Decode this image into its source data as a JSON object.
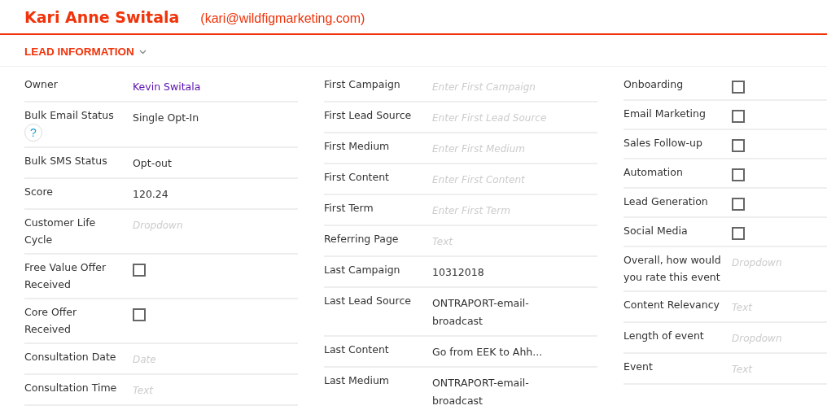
{
  "contact": {
    "name": "Kari Anne Switala",
    "email": "(kari@wildfigmarketing.com)"
  },
  "section": {
    "title": "LEAD INFORMATION",
    "expanded": true
  },
  "columns": [
    [
      {
        "label": "Owner",
        "kind": "link",
        "value": "Kevin Switala"
      },
      {
        "label": "Bulk Email Status",
        "kind": "value",
        "value": "Single Opt-In",
        "help": "?"
      },
      {
        "label": "Bulk SMS Status",
        "kind": "value",
        "value": "Opt-out"
      },
      {
        "label": "Score",
        "kind": "value",
        "value": "120.24"
      },
      {
        "label": "Customer Life Cycle",
        "kind": "empty",
        "placeholder": "Dropdown"
      },
      {
        "label": "Free Value Offer Received",
        "kind": "checkbox",
        "checked": false
      },
      {
        "label": "Core Offer Received",
        "kind": "checkbox",
        "checked": false
      },
      {
        "label": "Consultation Date",
        "kind": "empty",
        "placeholder": "Date"
      },
      {
        "label": "Consultation Time",
        "kind": "empty",
        "placeholder": "Text"
      }
    ],
    [
      {
        "label": "First Campaign",
        "kind": "empty",
        "placeholder": "Enter First Campaign"
      },
      {
        "label": "First Lead Source",
        "kind": "empty",
        "placeholder": "Enter First Lead Source"
      },
      {
        "label": "First Medium",
        "kind": "empty",
        "placeholder": "Enter First Medium"
      },
      {
        "label": "First Content",
        "kind": "empty",
        "placeholder": "Enter First Content"
      },
      {
        "label": "First Term",
        "kind": "empty",
        "placeholder": "Enter First Term"
      },
      {
        "label": "Referring Page",
        "kind": "empty",
        "placeholder": "Text"
      },
      {
        "label": "Last Campaign",
        "kind": "value",
        "value": "10312018"
      },
      {
        "label": "Last Lead Source",
        "kind": "value",
        "value": "ONTRAPORT-email-broadcast"
      },
      {
        "label": "Last Content",
        "kind": "value",
        "value": "Go from EEK to Ahh..."
      },
      {
        "label": "Last Medium",
        "kind": "value",
        "value": "ONTRAPORT-email-broadcast"
      }
    ],
    [
      {
        "label": "Onboarding",
        "kind": "checkbox",
        "checked": false
      },
      {
        "label": "Email Marketing",
        "kind": "checkbox",
        "checked": false
      },
      {
        "label": "Sales Follow-up",
        "kind": "checkbox",
        "checked": false
      },
      {
        "label": "Automation",
        "kind": "checkbox",
        "checked": false
      },
      {
        "label": "Lead Generation",
        "kind": "checkbox",
        "checked": false
      },
      {
        "label": "Social Media",
        "kind": "checkbox",
        "checked": false
      },
      {
        "label": "Overall, how would you rate this event",
        "kind": "empty",
        "placeholder": "Dropdown"
      },
      {
        "label": "Content Relevancy",
        "kind": "empty",
        "placeholder": "Text"
      },
      {
        "label": "Length of event",
        "kind": "empty",
        "placeholder": "Dropdown"
      },
      {
        "label": "Event",
        "kind": "empty",
        "placeholder": "Text"
      }
    ]
  ]
}
